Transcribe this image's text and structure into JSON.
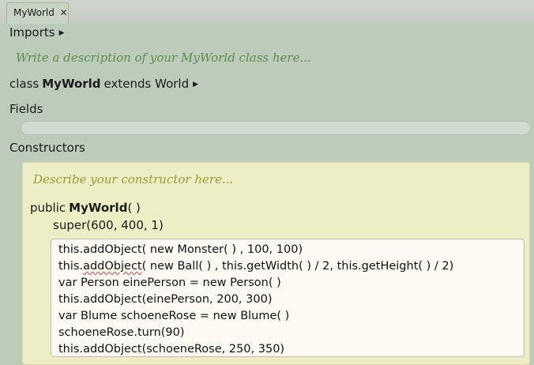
{
  "tab": {
    "title": "MyWorld",
    "close_glyph": "✕"
  },
  "editor": {
    "imports_label": "Imports",
    "class_comment": "Write a description of your MyWorld class here...",
    "class_kw": "class",
    "class_name": "MyWorld",
    "extends_kw": "extends",
    "superclass": "World",
    "fields_label": "Fields",
    "constructors_label": "Constructors",
    "constructor": {
      "comment": "Describe your constructor here...",
      "modifier": "public",
      "name": "MyWorld",
      "params": "( )",
      "super_call": "super(600, 400, 1)",
      "body": [
        "this.addObject( new  Monster( ) , 100, 100)",
        "this.addObject( new  Ball( ) , this.getWidth( ) / 2, this.getHeight( ) / 2)",
        "var Person einePerson =  new  Person( )",
        "this.addObject(einePerson, 200, 300)",
        "var Blume schoeneRose =  new  Blume( )",
        "schoeneRose.turn(90)",
        "this.addObject(schoeneRose, 250, 350)"
      ],
      "body_line2_prefix": "this.",
      "body_line2_squiggle": "addObject",
      "body_line2_rest": "( new  Ball( ) , this.getWidth( ) / 2, this.getHeight( ) / 2)"
    }
  }
}
